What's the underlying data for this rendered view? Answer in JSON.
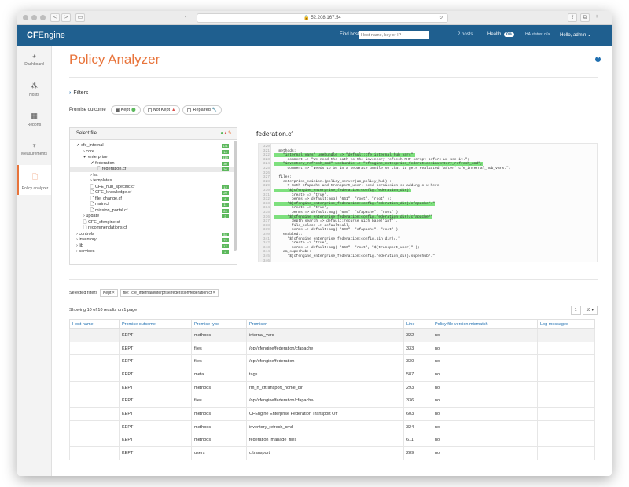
{
  "browser": {
    "url": "52.208.167.54",
    "back": "<",
    "forward": ">"
  },
  "topnav": {
    "logo_bold": "CF",
    "logo_rest": "Engine",
    "find_host_label": "Find host",
    "find_host_placeholder": "Host name, key or IP",
    "hosts": "2 hosts",
    "health_label": "Health",
    "health_value": "0%",
    "ha_status": "HA status: n/a",
    "user": "Hello, admin"
  },
  "sidebar": {
    "items": [
      {
        "label": "Dashboard",
        "icon": "dashboard-icon",
        "glyph": "◕"
      },
      {
        "label": "Hosts",
        "icon": "hosts-icon",
        "glyph": "⁂"
      },
      {
        "label": "Reports",
        "icon": "reports-icon",
        "glyph": "▦"
      },
      {
        "label": "Measurements",
        "icon": "measurements-icon",
        "glyph": "♆"
      },
      {
        "label": "Policy analyzer",
        "icon": "policy-analyzer-icon",
        "glyph": "🗋"
      }
    ]
  },
  "page": {
    "title": "Policy Analyzer",
    "filters_label": "Filters",
    "promise_outcome_label": "Promise outcome",
    "outcomes": [
      {
        "label": "Kept",
        "checked": true,
        "symbol": "⬤",
        "color": "#5cb85c"
      },
      {
        "label": "Not Kept",
        "checked": false,
        "symbol": "▲",
        "color": "#d9534f"
      },
      {
        "label": "Repaired",
        "checked": false,
        "symbol": "🔧",
        "color": "#e8743b"
      }
    ]
  },
  "tree": {
    "header": "Select file",
    "nodes": [
      {
        "label": "✔ cfe_internal",
        "depth": 0,
        "count": "131"
      },
      {
        "label": "› core",
        "depth": 1,
        "count": "10"
      },
      {
        "label": "✔ enterprise",
        "depth": 1,
        "count": "119"
      },
      {
        "label": "✔ federation",
        "depth": 2,
        "count": "30"
      },
      {
        "label": "🗋 federation.cf",
        "depth": 3,
        "count": "30",
        "selected": true
      },
      {
        "label": "› ha",
        "depth": 2,
        "count": ""
      },
      {
        "label": "› templates",
        "depth": 2,
        "count": ""
      },
      {
        "label": "🗋 CFE_hub_specific.cf",
        "depth": 2,
        "count": "12"
      },
      {
        "label": "🗋 CFE_knowledge.cf",
        "depth": 2,
        "count": "20"
      },
      {
        "label": "🗋 file_change.cf",
        "depth": 2,
        "count": "8"
      },
      {
        "label": "🗋 main.cf",
        "depth": 2,
        "count": "11"
      },
      {
        "label": "🗋 mission_portal.cf",
        "depth": 2,
        "count": "20"
      },
      {
        "label": "› update",
        "depth": 1,
        "count": "2"
      },
      {
        "label": "🗋 CFE_cfengine.cf",
        "depth": 1,
        "count": ""
      },
      {
        "label": "🗋 recommendations.cf",
        "depth": 1,
        "count": ""
      },
      {
        "label": "› controls",
        "depth": 0,
        "count": "54"
      },
      {
        "label": "› inventory",
        "depth": 0,
        "count": "79"
      },
      {
        "label": "› lib",
        "depth": 0,
        "count": "17"
      },
      {
        "label": "› services",
        "depth": 0,
        "count": "2"
      }
    ]
  },
  "code": {
    "filename": "federation.cf",
    "lines": [
      {
        "n": "320",
        "t": "",
        "hl": false
      },
      {
        "n": "321",
        "t": "  methods:",
        "hl": false
      },
      {
        "n": "322",
        "t": "    \"internal_vars\" usebundle => \"default:cfe_internal_hub_vars\",",
        "hl": true
      },
      {
        "n": "323",
        "t": "      comment => \"We need the path to the inventory refresh PHP script before we use it.\";",
        "hl": false
      },
      {
        "n": "324",
        "t": "    \"inventory_refresh_cmd\" usebundle => \"cfengine_enterprise_federation:inventory_refresh_cmd\",",
        "hl": true
      },
      {
        "n": "325",
        "t": "      comment => \"Needs to be in a separate bundle so that it gets evaluated *after* cfe_internal_hub_vars.\";",
        "hl": false
      },
      {
        "n": "326",
        "t": "",
        "hl": false
      },
      {
        "n": "327",
        "t": "  files:",
        "hl": false
      },
      {
        "n": "328",
        "t": "    enterprise_edition.(policy_server|am_policy_hub)::",
        "hl": false
      },
      {
        "n": "329",
        "t": "      # Both cfapache and transport_user) need permission so adding o+x here",
        "hl": false
      },
      {
        "n": "330",
        "t": "      \"$(cfengine_enterprise_federation:config.federation_dir)\"",
        "hl": true
      },
      {
        "n": "331",
        "t": "        create => \"true\",",
        "hl": false
      },
      {
        "n": "332",
        "t": "        perms => default:mog( \"661\", \"root\", \"root\" );",
        "hl": false
      },
      {
        "n": "333",
        "t": "      \"$(cfengine_enterprise_federation:config.federation_dir)/cfapache/.\"",
        "hl": true
      },
      {
        "n": "334",
        "t": "        create => \"true\",",
        "hl": false
      },
      {
        "n": "335",
        "t": "        perms => default:mog( \"600\", \"cfapache\", \"root\" );",
        "hl": false
      },
      {
        "n": "336",
        "t": "      \"$(cfengine_enterprise_federation:config.federation_dir)/cfapache/\"",
        "hl": true
      },
      {
        "n": "337",
        "t": "        depth_search => default:recurse_with_base(\"inf\"),",
        "hl": false
      },
      {
        "n": "338",
        "t": "        file_select => default:all,",
        "hl": false
      },
      {
        "n": "339",
        "t": "        perms => default:mog( \"600\", \"cfapache\", \"root\" );",
        "hl": false
      },
      {
        "n": "340",
        "t": "    enabled::",
        "hl": false
      },
      {
        "n": "341",
        "t": "      \"$(cfengine_enterprise_federation:config.bin_dir)/.\"",
        "hl": false
      },
      {
        "n": "342",
        "t": "        create => \"true\",",
        "hl": false
      },
      {
        "n": "343",
        "t": "        perms => default:mog( \"660\", \"root\", \"$(transport_user)\" );",
        "hl": false
      },
      {
        "n": "344",
        "t": "    am_superhub::",
        "hl": false
      },
      {
        "n": "345",
        "t": "      \"$(cfengine_enterprise_federation:config.federation_dir)/superhub/.\"",
        "hl": false
      },
      {
        "n": "346",
        "t": "",
        "hl": false
      }
    ]
  },
  "selected_filters": {
    "label": "Selected filters",
    "chips": [
      "Kept ×",
      "file: /cfe_internal/enterprise/federation/federation.cf ×"
    ]
  },
  "results": {
    "showing": "Showing 10 of 10 results on 1 page",
    "page": "1",
    "per_page": "10 ▾",
    "columns": [
      "Host name",
      "Promise outcome",
      "Promise type",
      "Promiser",
      "Line",
      "Policy file version mismatch",
      "Log messages"
    ],
    "rows": [
      [
        "",
        "KEPT",
        "methods",
        "internal_vars",
        "322",
        "no",
        ""
      ],
      [
        "",
        "KEPT",
        "files",
        "/opt/cfengine/federation/cfapache",
        "333",
        "no",
        ""
      ],
      [
        "",
        "KEPT",
        "files",
        "/opt/cfengine/federation",
        "330",
        "no",
        ""
      ],
      [
        "",
        "KEPT",
        "meta",
        "tags",
        "587",
        "no",
        ""
      ],
      [
        "",
        "KEPT",
        "methods",
        "rm_rf_cftransport_home_dir",
        "293",
        "no",
        ""
      ],
      [
        "",
        "KEPT",
        "files",
        "/opt/cfengine/federation/cfapache/.",
        "336",
        "no",
        ""
      ],
      [
        "",
        "KEPT",
        "methods",
        "CFEngine Enterprise Federation Transport Off",
        "603",
        "no",
        ""
      ],
      [
        "",
        "KEPT",
        "methods",
        "inventory_refresh_cmd",
        "324",
        "no",
        ""
      ],
      [
        "",
        "KEPT",
        "methods",
        "federation_manage_files",
        "611",
        "no",
        ""
      ],
      [
        "",
        "KEPT",
        "users",
        "cftransport",
        "289",
        "no",
        ""
      ]
    ]
  },
  "colors": {
    "brand": "#1f5f8f",
    "accent": "#e8743b",
    "highlight": "#7ee07e",
    "link": "#1f6fb0"
  }
}
